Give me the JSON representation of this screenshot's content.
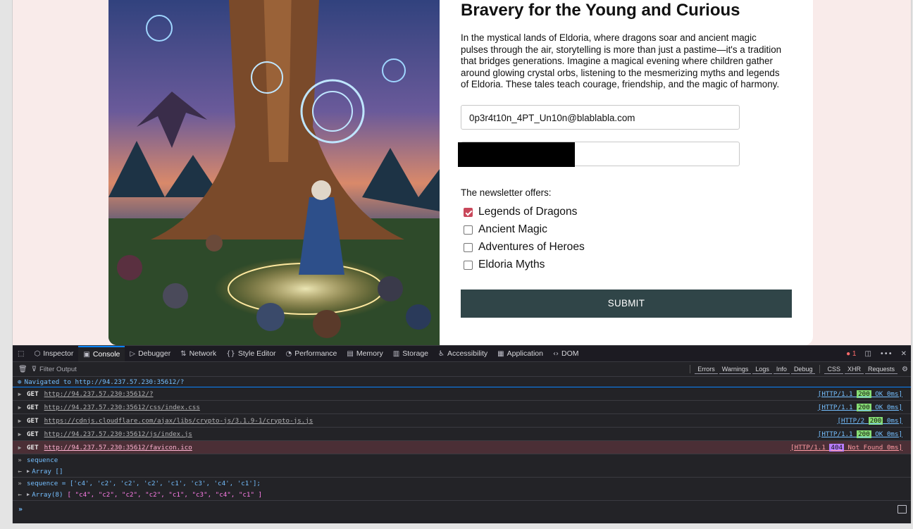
{
  "page": {
    "title": "Bravery for the Young and Curious",
    "intro": "In the mystical lands of Eldoria, where dragons soar and ancient magic pulses through the air, storytelling is more than just a pastime—it's a tradition that bridges generations. Imagine a magical evening where children gather around glowing crystal orbs, listening to the mesmerizing myths and legends of Eldoria. These tales teach courage, friendship, and the magic of harmony.",
    "email_value": "0p3r4t10n_4PT_Un10n@blablabla.com",
    "offers_label": "The newsletter offers:",
    "options": [
      {
        "label": "Legends of Dragons",
        "checked": true
      },
      {
        "label": "Ancient Magic",
        "checked": false
      },
      {
        "label": "Adventures of Heroes",
        "checked": false
      },
      {
        "label": "Eldoria Myths",
        "checked": false
      }
    ],
    "submit_label": "SUBMIT",
    "accent_color": "#c9485b",
    "button_color": "#304548"
  },
  "devtools": {
    "tabs": [
      "Inspector",
      "Console",
      "Debugger",
      "Network",
      "Style Editor",
      "Performance",
      "Memory",
      "Storage",
      "Accessibility",
      "Application",
      "DOM"
    ],
    "active_tab": "Console",
    "error_count": "1",
    "filter_placeholder": "Filter Output",
    "filters": [
      "Errors",
      "Warnings",
      "Logs",
      "Info",
      "Debug",
      "CSS",
      "XHR",
      "Requests"
    ],
    "navigated": "Navigated to http://94.237.57.230:35612/?",
    "requests": [
      {
        "method": "GET",
        "url": "http://94.237.57.230:35612/?",
        "proto": "[HTTP/1.1",
        "code": "200",
        "rest": " OK 0ms]"
      },
      {
        "method": "GET",
        "url": "http://94.237.57.230:35612/css/index.css",
        "proto": "[HTTP/1.1",
        "code": "200",
        "rest": " OK 0ms]"
      },
      {
        "method": "GET",
        "url": "https://cdnjs.cloudflare.com/ajax/libs/crypto-js/3.1.9-1/crypto-js.js",
        "proto": "[HTTP/2",
        "code": "200",
        "rest": "  0ms]"
      },
      {
        "method": "GET",
        "url": "http://94.237.57.230:35612/js/index.js",
        "proto": "[HTTP/1.1",
        "code": "200",
        "rest": " OK 0ms]"
      },
      {
        "method": "GET",
        "url": "http://94.237.57.230:35612/favicon.ico",
        "proto": "[HTTP/1.1",
        "code": "404",
        "rest": " Not Found 0ms]"
      }
    ],
    "input1": "sequence",
    "output1": "Array []",
    "input2": "sequence = ['c4', 'c2', 'c2', 'c2', 'c1', 'c3', 'c4', 'c1'];",
    "output2_prefix": "Array(8)",
    "output2_body": "[ \"c4\", \"c2\", \"c2\", \"c2\", \"c1\", \"c3\", \"c4\", \"c1\" ]"
  }
}
